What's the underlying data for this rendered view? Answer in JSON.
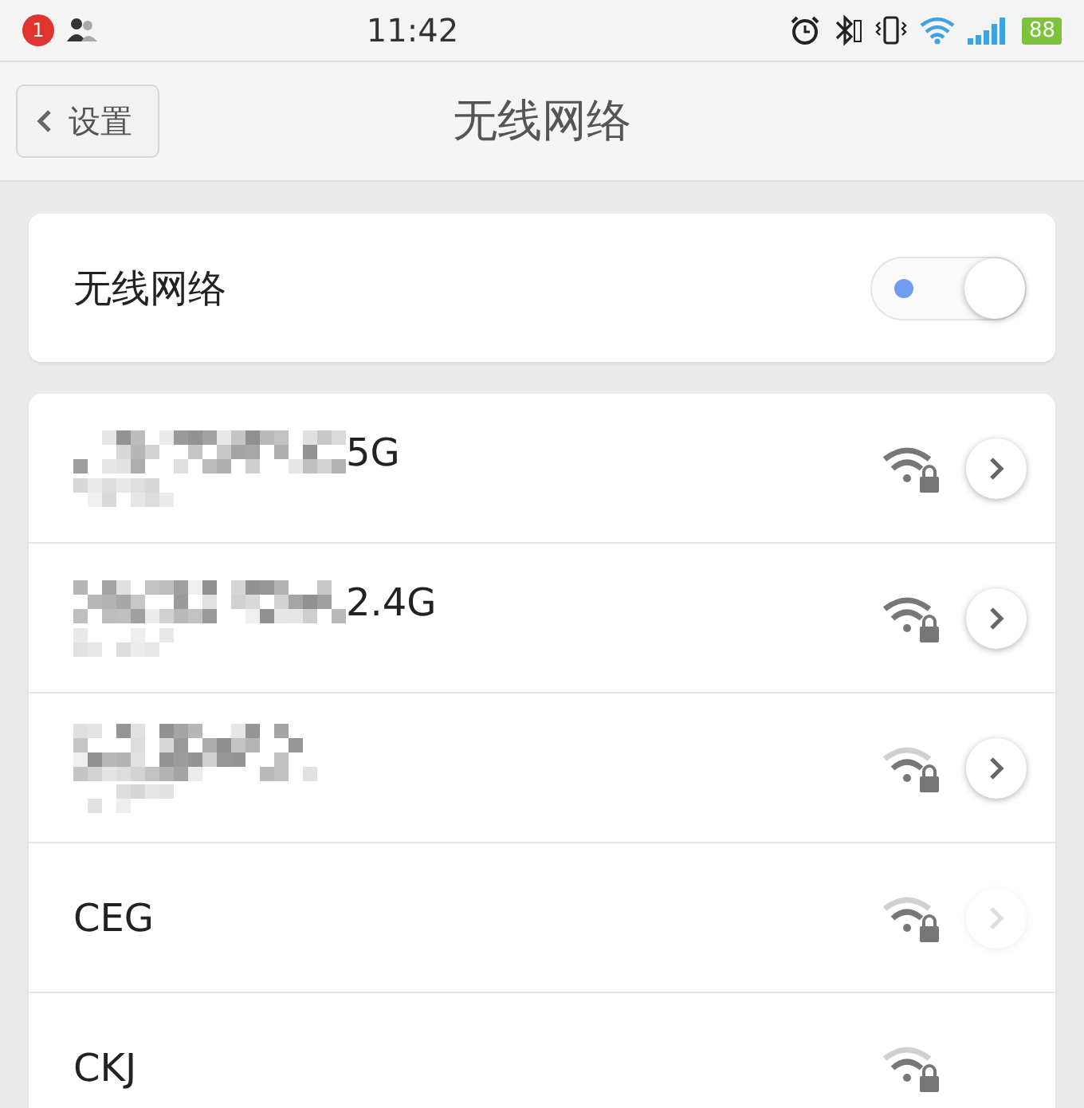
{
  "status_bar": {
    "notification_count": "1",
    "time": "11:42",
    "battery": "88"
  },
  "header": {
    "back_label": "设置",
    "title": "无线网络"
  },
  "wifi_toggle": {
    "label": "无线网络",
    "on": true
  },
  "networks": [
    {
      "masked": true,
      "name": "5G",
      "strong_signal": true,
      "detail_enabled": true
    },
    {
      "masked": true,
      "name": "2.4G",
      "strong_signal": true,
      "detail_enabled": true
    },
    {
      "masked": true,
      "strong_signal": false,
      "detail_enabled": true
    },
    {
      "masked": false,
      "name": "CEG",
      "strong_signal": false,
      "detail_enabled": false
    },
    {
      "masked": false,
      "name": "CKJ",
      "strong_signal": false
    }
  ]
}
